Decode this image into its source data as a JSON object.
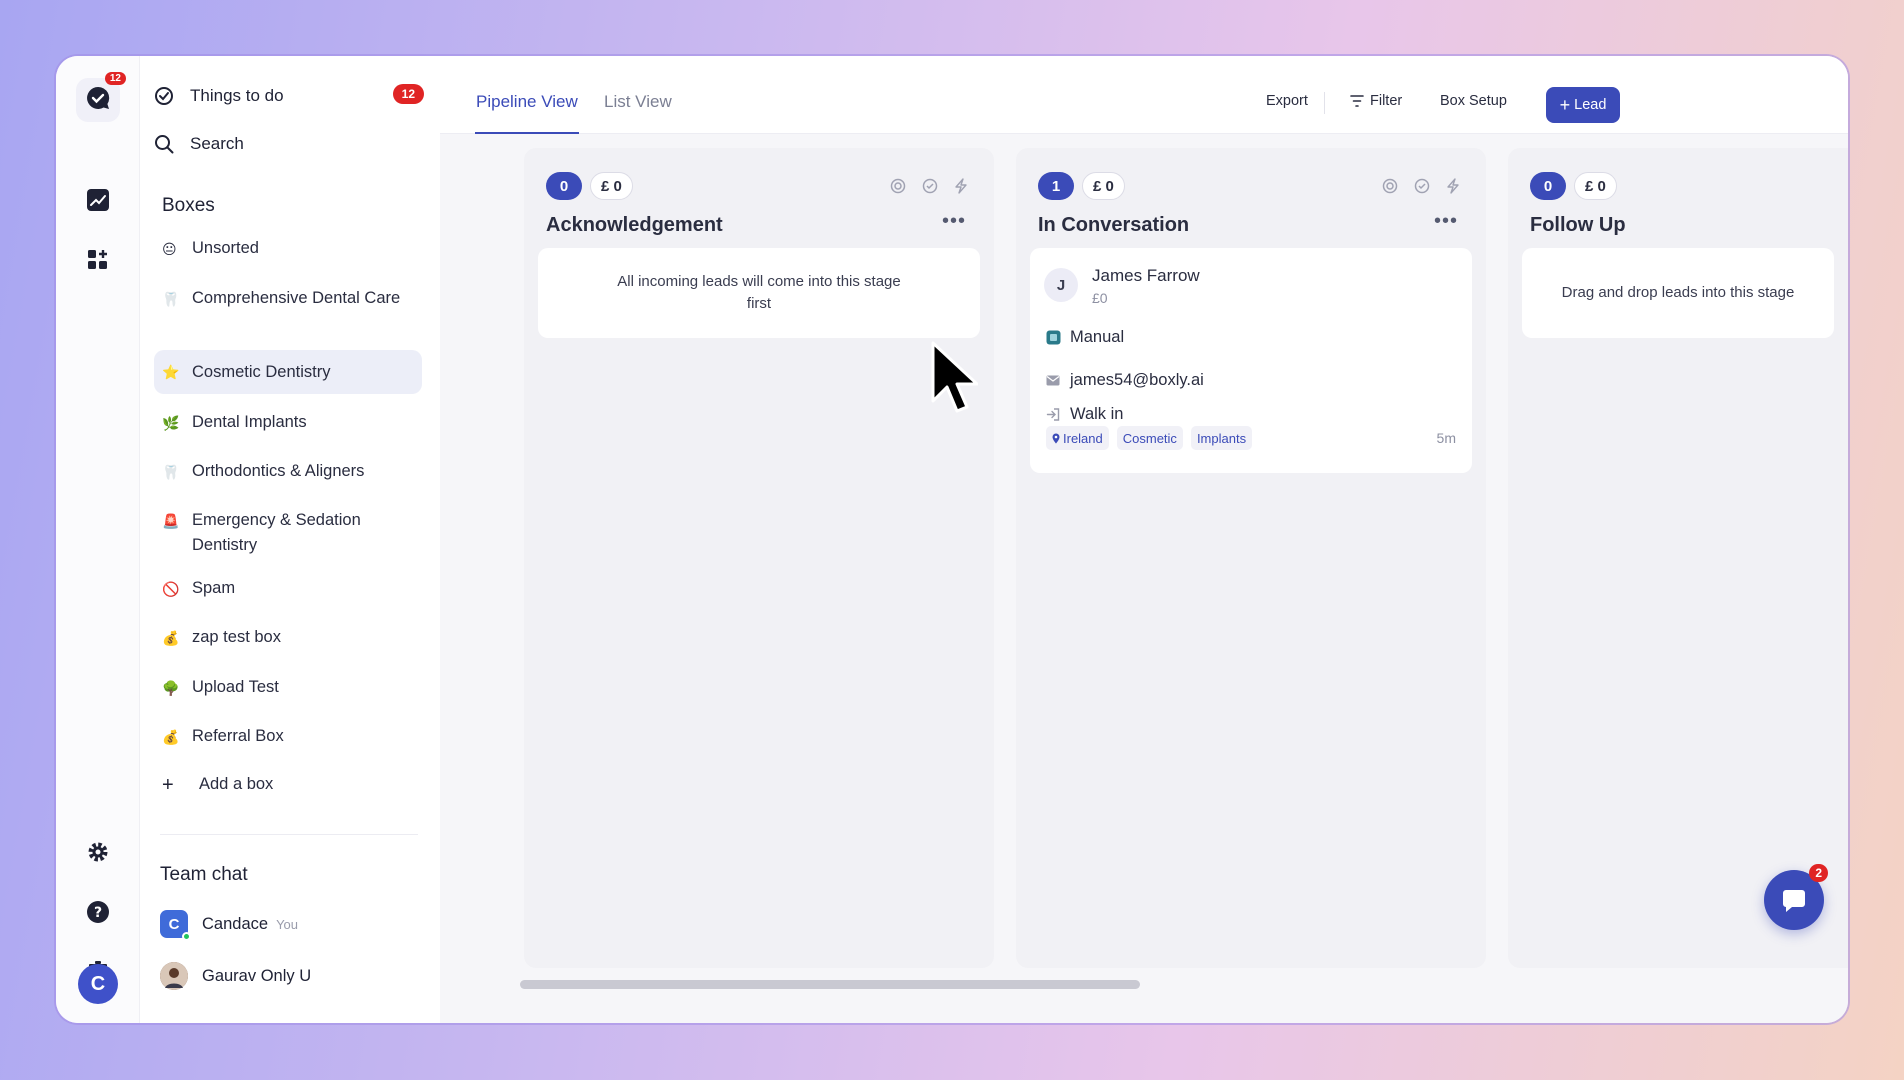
{
  "rail": {
    "logo_badge": "12"
  },
  "sidebar": {
    "things_to_do": {
      "label": "Things to do",
      "badge": "12"
    },
    "search": {
      "label": "Search"
    },
    "boxes_heading": "Boxes",
    "boxes": [
      {
        "emoji": "😐",
        "label": "Unsorted"
      },
      {
        "emoji": "🦷",
        "label": "Comprehensive Dental Care"
      },
      {
        "emoji": "⭐",
        "label": "Cosmetic Dentistry"
      },
      {
        "emoji": "🌿",
        "label": "Dental Implants"
      },
      {
        "emoji": "🦷",
        "label": "Orthodontics & Aligners"
      },
      {
        "emoji": "🚨",
        "label": "Emergency & Sedation Dentistry"
      },
      {
        "emoji": "🚫",
        "label": "Spam"
      },
      {
        "emoji": "💰",
        "label": "zap test box"
      },
      {
        "emoji": "🌳",
        "label": "Upload Test"
      },
      {
        "emoji": "💰",
        "label": "Referral Box"
      }
    ],
    "add_box": "Add a box",
    "team_chat_heading": "Team chat",
    "team_chat": [
      {
        "initial": "C",
        "name": "Candace",
        "suffix": "You"
      },
      {
        "initial": "",
        "name": "Gaurav Only U",
        "suffix": ""
      }
    ]
  },
  "user": {
    "initial": "C"
  },
  "toolbar": {
    "tabs": [
      "Pipeline View",
      "List View"
    ],
    "export": "Export",
    "filter": "Filter",
    "box_setup": "Box Setup",
    "lead": "Lead"
  },
  "columns": [
    {
      "count": "0",
      "money": "£ 0",
      "title": "Acknowledgement",
      "empty_text": "All incoming leads will come into this stage first"
    },
    {
      "count": "1",
      "money": "£ 0",
      "title": "In Conversation"
    },
    {
      "count": "0",
      "money": "£ 0",
      "title": "Follow Up",
      "empty_text": "Drag and drop leads into this stage"
    }
  ],
  "lead_card": {
    "initial": "J",
    "name": "James Farrow",
    "value": "£0",
    "source": "Manual",
    "email": "james54@boxly.ai",
    "channel": "Walk in",
    "tags": [
      "Ireland",
      "Cosmetic",
      "Implants"
    ],
    "time": "5m"
  },
  "chat_fab": {
    "badge": "2"
  },
  "colors": {
    "accent": "#3b4bb8",
    "badge": "#e02424"
  }
}
